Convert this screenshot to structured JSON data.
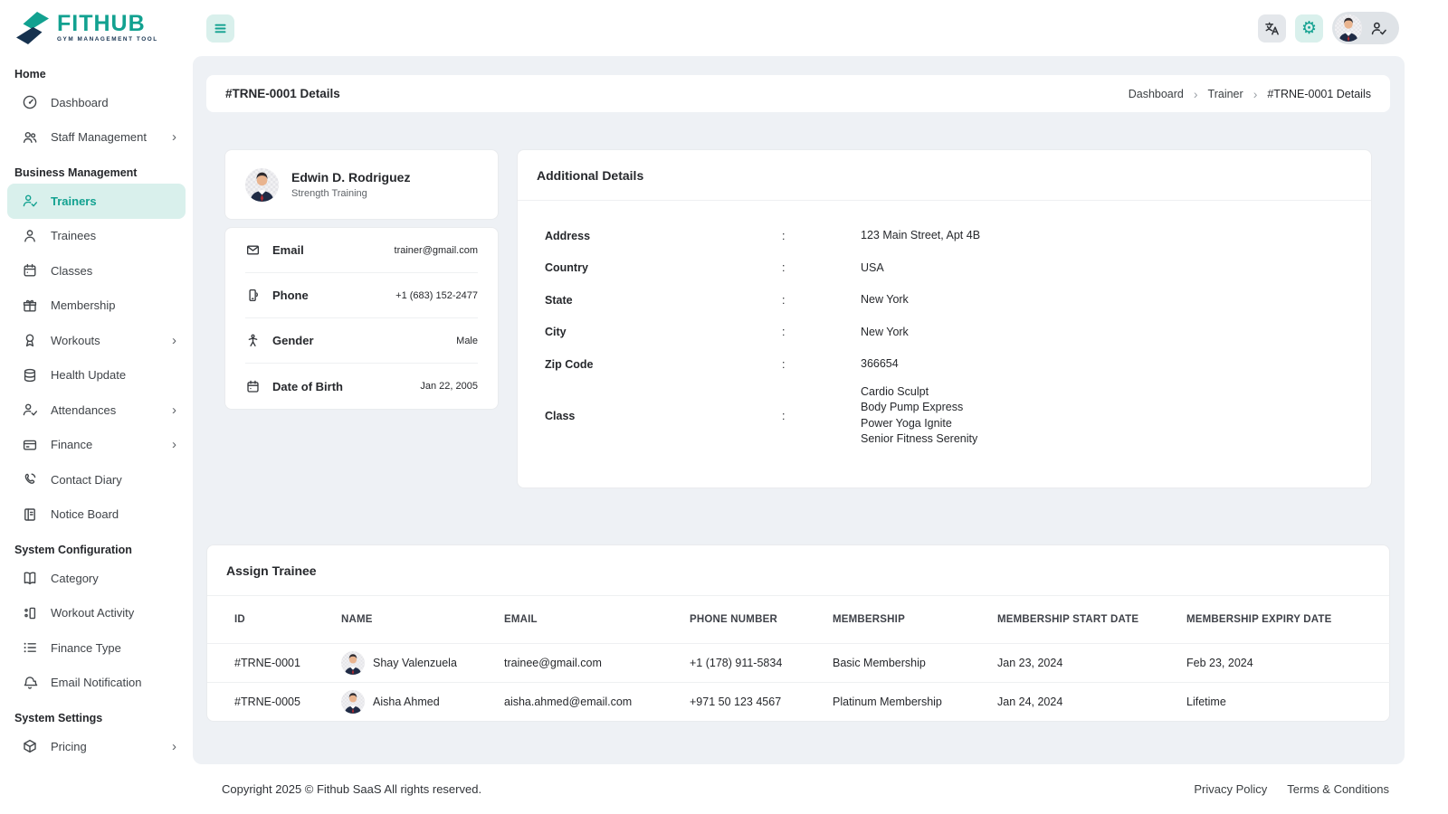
{
  "app": {
    "logo_name": "FITHUB",
    "logo_subtitle": "GYM MANAGEMENT TOOL"
  },
  "colors": {
    "accent": "#12a190",
    "accent_light": "#d9f0ec",
    "navy": "#16324f",
    "content_bg": "#eef1f5"
  },
  "header": {
    "icons": [
      "hamburger-menu-icon",
      "translate-icon",
      "settings-gear-icon",
      "profile-avatar",
      "person-check-icon"
    ],
    "settings_glyph": "⚙"
  },
  "sidebar": {
    "sections": [
      {
        "title": "Home",
        "items": [
          {
            "label": "Dashboard",
            "icon": "dashboard-icon",
            "chevron": false,
            "active": false
          },
          {
            "label": "Staff Management",
            "icon": "staff-users-icon",
            "chevron": true,
            "active": false
          }
        ]
      },
      {
        "title": "Business Management",
        "items": [
          {
            "label": "Trainers",
            "icon": "person-check-icon",
            "chevron": false,
            "active": true
          },
          {
            "label": "Trainees",
            "icon": "person-icon",
            "chevron": false,
            "active": false
          },
          {
            "label": "Classes",
            "icon": "calendar-icon",
            "chevron": false,
            "active": false
          },
          {
            "label": "Membership",
            "icon": "gift-icon",
            "chevron": false,
            "active": false
          },
          {
            "label": "Workouts",
            "icon": "award-icon",
            "chevron": true,
            "active": false
          },
          {
            "label": "Health Update",
            "icon": "database-icon",
            "chevron": false,
            "active": false
          },
          {
            "label": "Attendances",
            "icon": "person-check-icon",
            "chevron": true,
            "active": false
          },
          {
            "label": "Finance",
            "icon": "credit-card-icon",
            "chevron": true,
            "active": false
          },
          {
            "label": "Contact Diary",
            "icon": "phone-call-icon",
            "chevron": false,
            "active": false
          },
          {
            "label": "Notice Board",
            "icon": "notice-board-icon",
            "chevron": false,
            "active": false
          }
        ]
      },
      {
        "title": "System Configuration",
        "items": [
          {
            "label": "Category",
            "icon": "book-icon",
            "chevron": false,
            "active": false
          },
          {
            "label": "Workout Activity",
            "icon": "activity-grid-icon",
            "chevron": false,
            "active": false
          },
          {
            "label": "Finance Type",
            "icon": "list-icon",
            "chevron": false,
            "active": false
          },
          {
            "label": "Email Notification",
            "icon": "bell-icon",
            "chevron": false,
            "active": false
          }
        ]
      },
      {
        "title": "System Settings",
        "items": [
          {
            "label": "Pricing",
            "icon": "box-icon",
            "chevron": true,
            "active": false
          }
        ]
      }
    ]
  },
  "page": {
    "title": "#TRNE-0001 Details",
    "breadcrumb": [
      "Dashboard",
      "Trainer",
      "#TRNE-0001 Details"
    ]
  },
  "profile": {
    "name": "Edwin D. Rodriguez",
    "specialty": "Strength Training",
    "fields": [
      {
        "label": "Email",
        "value": "trainer@gmail.com",
        "icon": "mail-icon"
      },
      {
        "label": "Phone",
        "value": "+1 (683) 152-2477",
        "icon": "smartphone-icon"
      },
      {
        "label": "Gender",
        "value": "Male",
        "icon": "body-icon"
      },
      {
        "label": "Date of Birth",
        "value": "Jan 22, 2005",
        "icon": "calendar-icon"
      }
    ]
  },
  "additional": {
    "title": "Additional Details",
    "separator": ":",
    "rows": [
      {
        "label": "Address",
        "lines": [
          "123 Main Street, Apt 4B"
        ]
      },
      {
        "label": "Country",
        "lines": [
          "USA"
        ]
      },
      {
        "label": "State",
        "lines": [
          "New York"
        ]
      },
      {
        "label": "City",
        "lines": [
          "New York"
        ]
      },
      {
        "label": "Zip Code",
        "lines": [
          "366654"
        ]
      },
      {
        "label": "Class",
        "lines": [
          "Cardio Sculpt",
          "Body Pump Express",
          "Power Yoga Ignite",
          "Senior Fitness Serenity"
        ]
      }
    ]
  },
  "assign": {
    "title": "Assign Trainee",
    "columns": [
      "ID",
      "NAME",
      "EMAIL",
      "PHONE NUMBER",
      "MEMBERSHIP",
      "MEMBERSHIP START DATE",
      "MEMBERSHIP EXPIRY DATE"
    ],
    "rows": [
      {
        "id": "#TRNE-0001",
        "name": "Shay Valenzuela",
        "email": "trainee@gmail.com",
        "phone": "+1 (178) 911-5834",
        "membership": "Basic Membership",
        "start": "Jan 23, 2024",
        "expiry": "Feb 23, 2024"
      },
      {
        "id": "#TRNE-0005",
        "name": "Aisha Ahmed",
        "email": "aisha.ahmed@email.com",
        "phone": "+971 50 123 4567",
        "membership": "Platinum Membership",
        "start": "Jan 24, 2024",
        "expiry": "Lifetime"
      }
    ]
  },
  "footer": {
    "copyright": "Copyright 2025 © Fithub SaaS All rights reserved.",
    "links": [
      "Privacy Policy",
      "Terms & Conditions"
    ]
  }
}
